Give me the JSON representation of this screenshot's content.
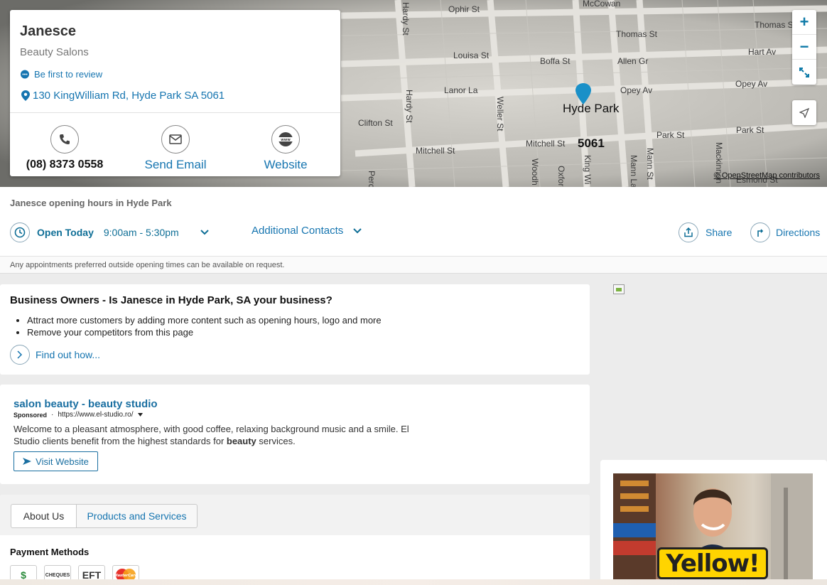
{
  "map": {
    "streets": [
      "Ophir St",
      "McCowan",
      "Thomas St",
      "Thomas St",
      "Hart Av",
      "Louisa St",
      "Boffa St",
      "Allen Gr",
      "Lanor La",
      "Opey Av",
      "Opey Av",
      "Clifton St",
      "Mitchell St",
      "Mitchell St",
      "Park St",
      "Park St",
      "Esmond St",
      "Hardy St",
      "Hardy St",
      "Weller St",
      "King Wi",
      "Mann La",
      "Mann St",
      "Mackinnon",
      "Oxford",
      "Woodh",
      "Perc"
    ],
    "suburb": "Hyde Park",
    "postcode": "5061",
    "attribution": "© OpenStreetMap contributors",
    "zoom_in": "+",
    "zoom_out": "−"
  },
  "business": {
    "name": "Janesce",
    "category": "Beauty Salons",
    "review_link": "Be first to review",
    "address": "130 KingWilliam Rd, Hyde Park SA 5061",
    "phone": "(08) 8373 0558",
    "email_label": "Send Email",
    "website_label": "Website"
  },
  "hours": {
    "title": "Janesce opening hours in Hyde Park",
    "status": "Open Today",
    "time": "9:00am - 5:30pm",
    "additional_contacts": "Additional Contacts",
    "share": "Share",
    "directions": "Directions",
    "note": "Any appointments preferred outside opening times can be available on request."
  },
  "owner_promo": {
    "title": "Business Owners - Is Janesce in Hyde Park, SA your business?",
    "bullets": [
      "Attract more customers by adding more content such as opening hours, logo and more",
      "Remove your competitors from this page"
    ],
    "cta": "Find out how..."
  },
  "ad": {
    "title": "salon beauty - beauty studio",
    "sponsored": "Sponsored",
    "dot": "·",
    "url": "https://www.el-studio.ro/",
    "description_prefix": "Welcome to a pleasant atmosphere, with good coffee, relaxing background music and a smile. El Studio clients benefit from the highest standards for ",
    "description_bold": "beauty",
    "description_suffix": " services.",
    "button": "Visit Website"
  },
  "tabs": [
    {
      "label": "About Us",
      "active": true
    },
    {
      "label": "Products and Services",
      "active": false
    }
  ],
  "payment": {
    "title": "Payment Methods",
    "methods": [
      "$",
      "CHEQUES",
      "EFT",
      "MasterCard"
    ]
  },
  "side_ad": {
    "brand": "Yellow!"
  },
  "colors": {
    "link": "#1675b0",
    "accent": "#0e6e96",
    "brand_yellow": "#ffd400"
  }
}
